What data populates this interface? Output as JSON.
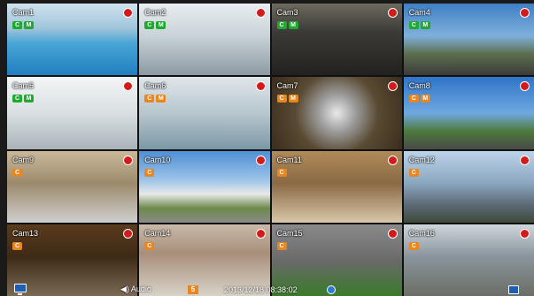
{
  "cameras": [
    {
      "label": "Cam1",
      "badges": [
        "C",
        "M"
      ],
      "badge_color": "green"
    },
    {
      "label": "Cam2",
      "badges": [
        "C",
        "M"
      ],
      "badge_color": "green"
    },
    {
      "label": "Cam3",
      "badges": [
        "C",
        "M"
      ],
      "badge_color": "green"
    },
    {
      "label": "Cam4",
      "badges": [
        "C",
        "M"
      ],
      "badge_color": "green"
    },
    {
      "label": "Cam5",
      "badges": [
        "C",
        "M"
      ],
      "badge_color": "green"
    },
    {
      "label": "Cam6",
      "badges": [
        "C",
        "M"
      ],
      "badge_color": "orange"
    },
    {
      "label": "Cam7",
      "badges": [
        "C",
        "M"
      ],
      "badge_color": "orange"
    },
    {
      "label": "Cam8",
      "badges": [
        "C",
        "M"
      ],
      "badge_color": "orange"
    },
    {
      "label": "Cam9",
      "badges": [
        "C"
      ],
      "badge_color": "orange"
    },
    {
      "label": "Cam10",
      "badges": [
        "C"
      ],
      "badge_color": "orange"
    },
    {
      "label": "Cam11",
      "badges": [
        "C"
      ],
      "badge_color": "orange"
    },
    {
      "label": "Cam12",
      "badges": [
        "C"
      ],
      "badge_color": "orange"
    },
    {
      "label": "Cam13",
      "badges": [
        "C"
      ],
      "badge_color": "orange"
    },
    {
      "label": "Cam14",
      "badges": [
        "C"
      ],
      "badge_color": "orange"
    },
    {
      "label": "Cam15",
      "badges": [
        "C"
      ],
      "badge_color": "orange"
    },
    {
      "label": "Cam16",
      "badges": [
        "C"
      ],
      "badge_color": "orange"
    }
  ],
  "status_bar": {
    "audio_label": "Audio",
    "audio_channel": "5",
    "datetime": "2013/12/18 08:38:02"
  },
  "colors": {
    "selected_border": "#2aa3e6",
    "record_indicator": "#d21c1c",
    "badge_green": "#1faa2f",
    "badge_orange": "#e8871f"
  },
  "icons": [
    "record-icon",
    "monitor-icon",
    "speaker-icon",
    "network-icon",
    "settings-icon"
  ]
}
